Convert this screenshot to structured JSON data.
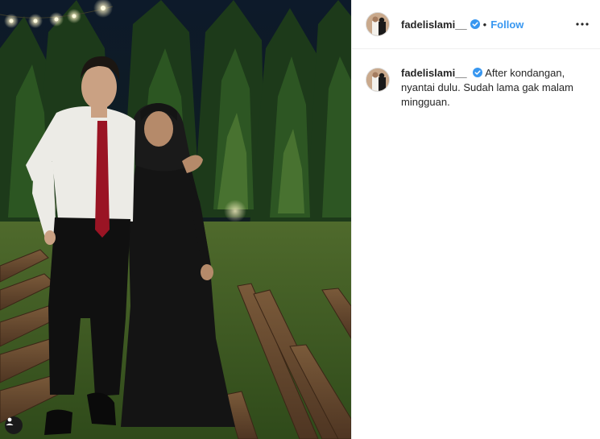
{
  "post": {
    "author": {
      "username": "fadelislami__",
      "verified": true,
      "verified_icon": "verified-badge-icon",
      "follow_label": "Follow",
      "separator": "•"
    },
    "caption": {
      "username": "fadelislami__",
      "text": "After kondangan, nyantai dulu. Sudah lama gak malam mingguan."
    },
    "more_icon": "more-options-icon",
    "tag_icon": "user-tag-icon"
  },
  "colors": {
    "accent": "#3897f0",
    "text": "#262626",
    "border": "#efefef"
  }
}
